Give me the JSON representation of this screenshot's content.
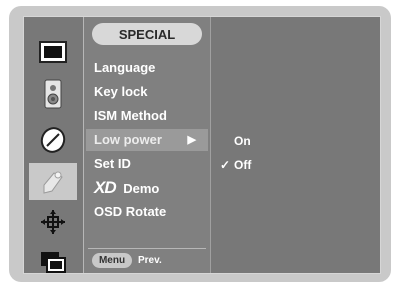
{
  "menu": {
    "title": "SPECIAL",
    "items": [
      {
        "label": "Language"
      },
      {
        "label": "Key lock"
      },
      {
        "label": "ISM Method"
      },
      {
        "label": "Low power",
        "arrow": "▶"
      },
      {
        "label": "Set ID"
      },
      {
        "logo": "XD",
        "label": "Demo"
      },
      {
        "label": "OSD Rotate"
      }
    ],
    "selected_index": 3
  },
  "submenu": {
    "options": [
      {
        "label": "On",
        "checked": false
      },
      {
        "label": "Off",
        "checked": true,
        "check_mark": "✓"
      }
    ]
  },
  "footer": {
    "menu_button": "Menu",
    "prev_label": "Prev."
  },
  "icons": [
    {
      "name": "picture-icon"
    },
    {
      "name": "audio-speaker-icon"
    },
    {
      "name": "timer-icon"
    },
    {
      "name": "special-icon",
      "active": true
    },
    {
      "name": "screen-adjust-icon"
    },
    {
      "name": "pip-icon"
    }
  ],
  "colors": {
    "osd_background": "#787878",
    "frame": "#c9c9c9",
    "active_icon_bg": "#c9c9c9",
    "selected_row": "#9a9a9a",
    "text": "#ffffff"
  }
}
